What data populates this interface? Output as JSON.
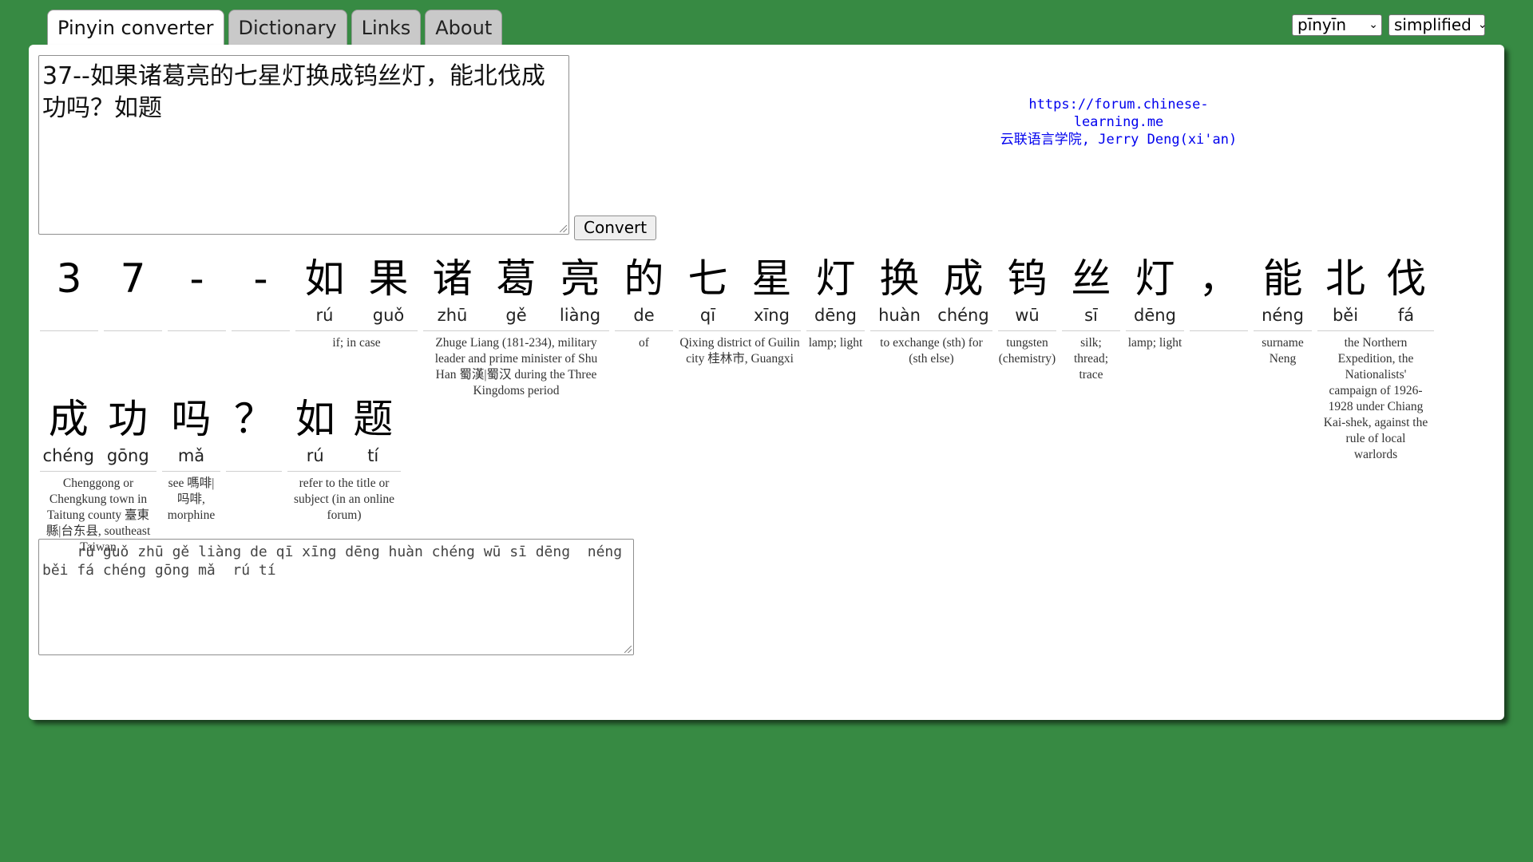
{
  "tabs": [
    {
      "label": "Pinyin converter",
      "active": true
    },
    {
      "label": "Dictionary",
      "active": false
    },
    {
      "label": "Links",
      "active": false
    },
    {
      "label": "About",
      "active": false
    }
  ],
  "selects": {
    "romanization": "pīnyīn",
    "script": "simplified"
  },
  "input": {
    "text": "37--如果诸葛亮的七星灯换成钨丝灯，能北伐成功吗？如题"
  },
  "convert_label": "Convert",
  "credit": {
    "line1": "https://forum.chinese-learning.me",
    "line2": "云联语言学院, Jerry Deng(xi'an)"
  },
  "row1": [
    {
      "hz": "3",
      "py": ""
    },
    {
      "hz": "7",
      "py": ""
    },
    {
      "hz": "-",
      "py": ""
    },
    {
      "hz": "-",
      "py": ""
    },
    {
      "hz": "如",
      "py": "rú"
    },
    {
      "hz": "果",
      "py": "guǒ"
    },
    {
      "hz": "诸",
      "py": "zhū"
    },
    {
      "hz": "葛",
      "py": "gě"
    },
    {
      "hz": "亮",
      "py": "liàng"
    },
    {
      "hz": "的",
      "py": "de"
    },
    {
      "hz": "七",
      "py": "qī"
    },
    {
      "hz": "星",
      "py": "xīng"
    },
    {
      "hz": "灯",
      "py": "dēng"
    },
    {
      "hz": "换",
      "py": "huàn"
    },
    {
      "hz": "成",
      "py": "chéng"
    },
    {
      "hz": "钨",
      "py": "wū"
    },
    {
      "hz": "丝",
      "py": "sī"
    },
    {
      "hz": "灯",
      "py": "dēng"
    },
    {
      "hz": "，",
      "py": ""
    },
    {
      "hz": "能",
      "py": "néng"
    },
    {
      "hz": "北",
      "py": "běi"
    },
    {
      "hz": "伐",
      "py": "fá"
    }
  ],
  "row2": [
    {
      "hz": "成",
      "py": "chéng"
    },
    {
      "hz": "功",
      "py": "gōng"
    },
    {
      "hz": "吗",
      "py": "mǎ"
    },
    {
      "hz": "？",
      "py": ""
    },
    {
      "hz": "如",
      "py": "rú"
    },
    {
      "hz": "题",
      "py": "tí"
    }
  ],
  "definitions": {
    "ruguo": "if; in case",
    "zhugeliang": "Zhuge Liang (181-234), military leader and prime minister of Shu Han 蜀漢|蜀汉 during the Three Kingdoms period",
    "de": "of",
    "qixing": "Qixing district of Guilin city 桂林市, Guangxi",
    "deng1": "lamp; light",
    "huancheng": "to exchange (sth) for (sth else)",
    "wu": "tungsten (chemistry)",
    "si": "silk; thread; trace",
    "deng2": "lamp; light",
    "neng": "surname Neng",
    "beifa": "the Northern Expedition, the Nationalists' campaign of 1926-1928 under Chiang Kai-shek, against the rule of local warlords",
    "chenggong": "Chenggong or Chengkung town in Taitung county 臺東縣|台东县, southeast Taiwan",
    "ma": "see 嗎啡|吗啡, morphine",
    "ruti": "refer to the title or subject (in an online forum)"
  },
  "output": {
    "text": "    rú guǒ zhū gě liàng de qī xīng dēng huàn chéng wū sī dēng  néng běi fá chéng gōng mǎ  rú tí"
  }
}
